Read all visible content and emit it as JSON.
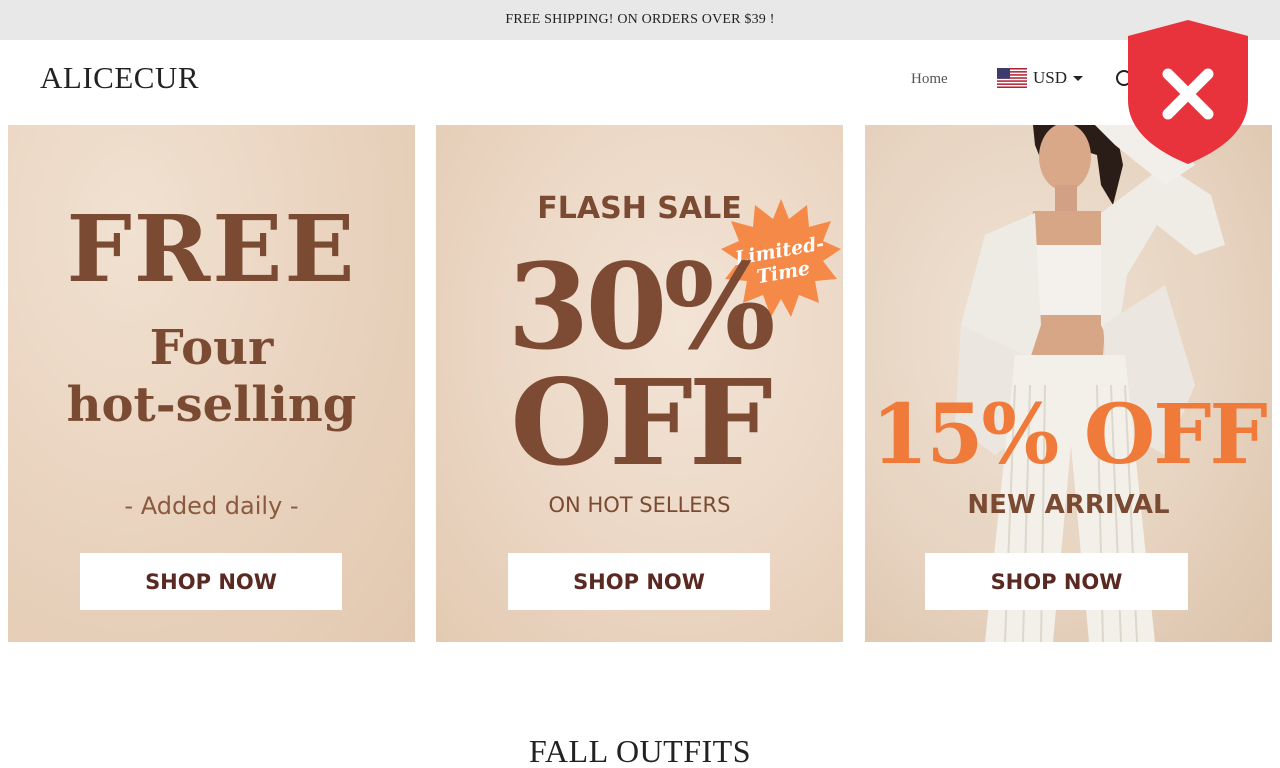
{
  "announcement": "FREE SHIPPING! ON ORDERS OVER $39 !",
  "header": {
    "logo": "ALICECUR",
    "nav": {
      "home": "Home"
    },
    "currency": {
      "label": "USD",
      "flag_icon": "us-flag-icon"
    },
    "search_icon": "search-icon"
  },
  "overlay": {
    "icon": "shield-x-icon",
    "color": "#e8323c"
  },
  "banners": [
    {
      "line1": "FREE",
      "line2": "Four",
      "line3": "hot-selling",
      "line4": "- Added daily -",
      "button": "SHOP NOW"
    },
    {
      "line1": "FLASH SALE",
      "badge_line1": "Limited-",
      "badge_line2": "Time",
      "line2": "30%",
      "line3": "OFF",
      "line4": "ON HOT SELLERS",
      "button": "SHOP NOW"
    },
    {
      "line1": "15% OFF",
      "line2": "NEW ARRIVAL",
      "button": "SHOP NOW"
    }
  ],
  "section": {
    "title": "FALL OUTFITS"
  },
  "colors": {
    "banner_text": "#7a4a32",
    "accent_orange": "#f07a3a",
    "badge_orange": "#f58a48"
  }
}
